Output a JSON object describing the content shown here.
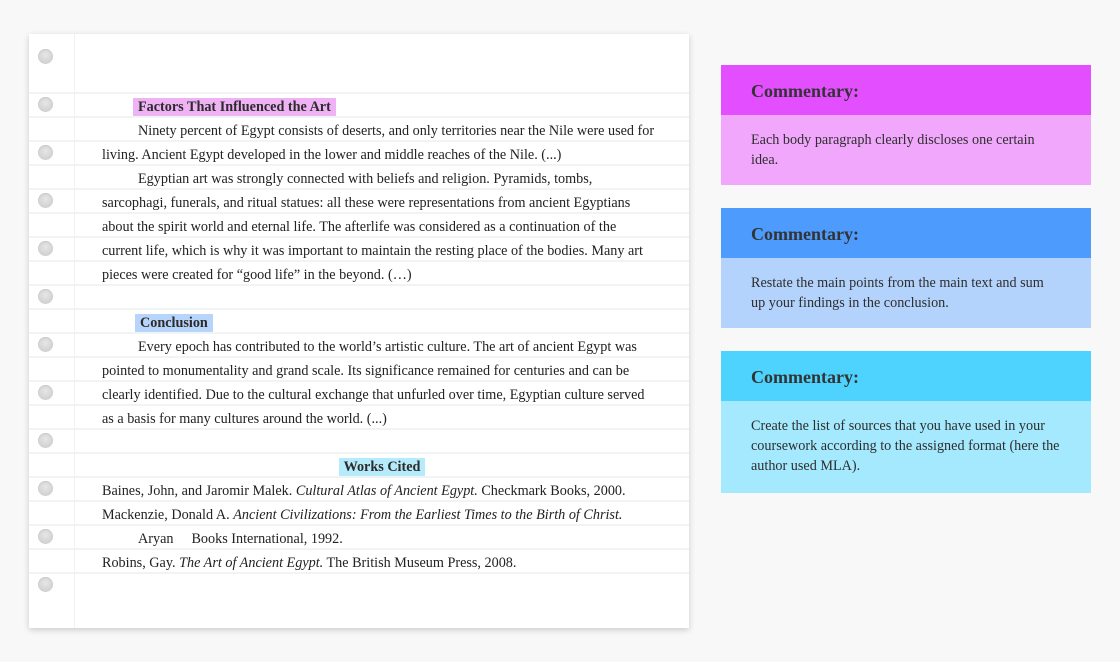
{
  "document": {
    "sections": {
      "factors": {
        "heading": "Factors That Influenced the Art",
        "lines": [
          "Ninety percent of Egypt consists of deserts, and only territories near the Nile were used for",
          "living. Ancient Egypt developed in the lower and middle reaches of the Nile. (...)",
          "Egyptian art was strongly connected with beliefs and religion. Pyramids, tombs,",
          "sarcophagi, funerals, and ritual statues: all these were representations from ancient Egyptians",
          "about the spirit world and eternal life. The afterlife was considered as a continuation of the",
          "current life, which is why it was important to maintain the resting place of the bodies. Many art",
          "pieces were created for “good life” in the beyond. (…)"
        ]
      },
      "conclusion": {
        "heading": "Conclusion",
        "lines": [
          "Every epoch has contributed to the world’s artistic culture. The art of ancient Egypt was",
          "pointed to monumentality and grand scale. Its significance remained for centuries and can be",
          "clearly identified. Due to the cultural exchange that unfurled over time, Egyptian culture served",
          "as a basis for many cultures around the world. (...)"
        ]
      },
      "works_cited": {
        "heading": "Works Cited",
        "entries": [
          {
            "before": "Baines, John, and Jaromir Malek. ",
            "title": "Cultural Atlas of Ancient Egypt.",
            "after": " Checkmark Books, 2000."
          },
          {
            "before": "Mackenzie, Donald A. ",
            "title": "Ancient Civilizations: From the Earliest Times to the Birth of Christ.",
            "after": "",
            "continuation_a": "Aryan",
            "continuation_b": "Books International, 1992."
          },
          {
            "before": "Robins, Gay. ",
            "title": "The Art of Ancient Egypt.",
            "after": " The British Museum Press, 2008."
          }
        ]
      }
    }
  },
  "commentary": [
    {
      "title": "Commentary:",
      "text": "Each body paragraph clearly discloses one certain idea.",
      "header_color": "#e34ffe",
      "body_color": "#f1a8fc"
    },
    {
      "title": "Commentary:",
      "text": "Restate the main points from the main text and sum up your findings in the conclusion.",
      "header_color": "#4e9bfe",
      "body_color": "#b3d3fd"
    },
    {
      "title": "Commentary:",
      "text": "Create the list of sources that you have used in your coursework according to the assigned format (here the author used MLA).",
      "header_color": "#4dd3fe",
      "body_color": "#a4e9fd"
    }
  ],
  "highlight_colors": {
    "factors": "#efb3f5",
    "conclusion": "#b7d4fb",
    "works_cited": "#b6ebfb"
  }
}
